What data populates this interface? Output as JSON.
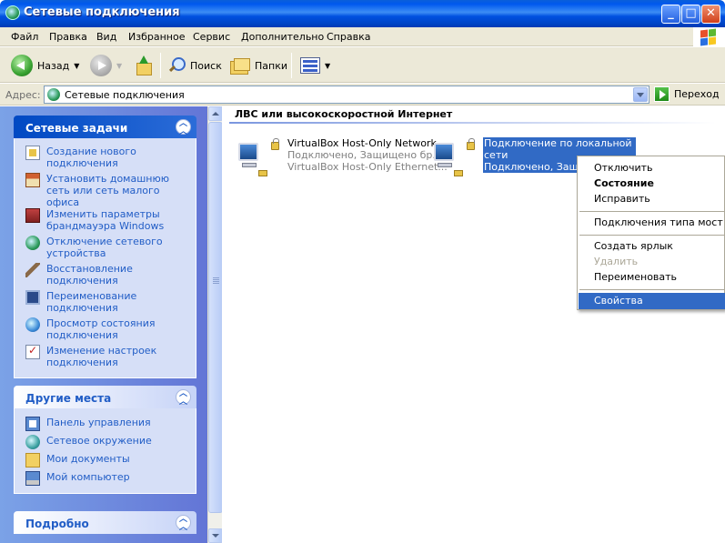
{
  "window": {
    "title": "Сетевые подключения"
  },
  "menu": [
    "Файл",
    "Правка",
    "Вид",
    "Избранное",
    "Сервис",
    "Дополнительно",
    "Справка"
  ],
  "toolbar": {
    "back_label": "Назад",
    "search_label": "Поиск",
    "folders_label": "Папки"
  },
  "address": {
    "label": "Адрес:",
    "value": "Сетевые подключения",
    "go_label": "Переход"
  },
  "tasks_panel": {
    "title": "Сетевые задачи",
    "items": [
      {
        "label": "Создание нового подключения",
        "icon": "new-connection-icon"
      },
      {
        "label": "Установить домашнюю сеть или сеть малого офиса",
        "icon": "home-network-icon"
      },
      {
        "label": "Изменить параметры брандмауэра Windows",
        "icon": "firewall-icon"
      },
      {
        "label": "Отключение сетевого устройства",
        "icon": "disable-device-icon"
      },
      {
        "label": "Восстановление подключения",
        "icon": "repair-icon"
      },
      {
        "label": "Переименование подключения",
        "icon": "rename-icon"
      },
      {
        "label": "Просмотр состояния подключения",
        "icon": "status-icon"
      },
      {
        "label": "Изменение настроек подключения",
        "icon": "settings-icon"
      }
    ]
  },
  "places_panel": {
    "title": "Другие места",
    "items": [
      {
        "label": "Панель управления",
        "icon": "control-panel-icon"
      },
      {
        "label": "Сетевое окружение",
        "icon": "network-places-icon"
      },
      {
        "label": "Мои документы",
        "icon": "my-documents-icon"
      },
      {
        "label": "Мой компьютер",
        "icon": "my-computer-icon"
      }
    ]
  },
  "details_panel": {
    "title": "Подробно"
  },
  "content": {
    "group_header": "ЛВС или высокоскоростной Интернет",
    "connections": [
      {
        "name": "VirtualBox Host-Only Network",
        "status": "Подключено, Защищено бр...",
        "device": "VirtualBox Host-Only Ethernet..."
      },
      {
        "name_line1": "Подключение по локальной",
        "name_line2": "сети",
        "status": "Подключено, Защищ"
      }
    ]
  },
  "context_menu": {
    "items": [
      "Отключить",
      "Состояние",
      "Исправить",
      "Подключения типа мост",
      "Создать ярлык",
      "Удалить",
      "Переименовать",
      "Свойства"
    ],
    "default_item": "Состояние",
    "disabled_item": "Удалить",
    "highlighted_item": "Свойства"
  }
}
